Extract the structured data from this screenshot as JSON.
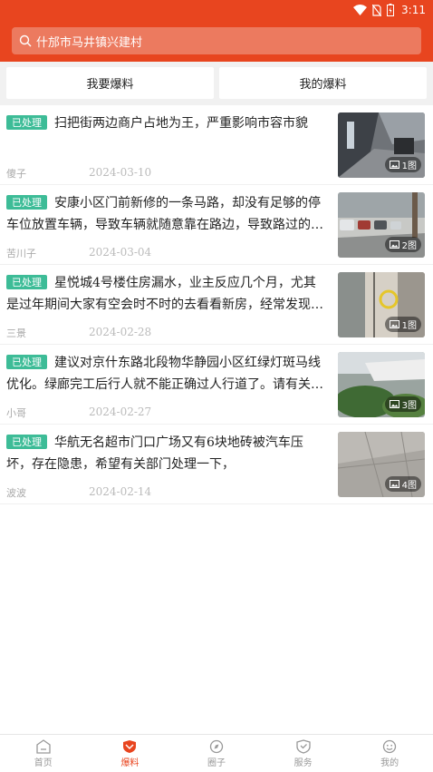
{
  "status_bar": {
    "time": "3:11"
  },
  "search": {
    "placeholder": "什邡市马井镇兴建村"
  },
  "tabs": [
    {
      "label": "我要爆料"
    },
    {
      "label": "我的爆料"
    }
  ],
  "items": [
    {
      "status": "已处理",
      "title": "扫把街两边商户占地为王，严重影响市容市貌",
      "author": "傻子",
      "date": "2024-03-10",
      "image_count": "1图"
    },
    {
      "status": "已处理",
      "title": "安康小区门前新修的一条马路，却没有足够的停车位放置车辆，导致车辆就随意靠在路边，导致路过的行人通行困难",
      "author": "苦川子",
      "date": "2024-03-04",
      "image_count": "2图"
    },
    {
      "status": "已处理",
      "title": "星悦城4号楼住房漏水，业主反应几个月，尤其是过年期间大家有空会时不时的去看看新房，经常发现漏水",
      "author": "三景",
      "date": "2024-02-28",
      "image_count": "1图"
    },
    {
      "status": "已处理",
      "title": "建议对京什东路北段物华静园小区红绿灯斑马线优化。绿廊完工后行人就不能正确过人行道了。请有关部门尽快处理",
      "author": "小哥",
      "date": "2024-02-27",
      "image_count": "3图"
    },
    {
      "status": "已处理",
      "title": "华航无名超市门口广场又有6块地砖被汽车压坏，存在隐患，希望有关部门处理一下，",
      "author": "波波",
      "date": "2024-02-14",
      "image_count": "4图"
    }
  ],
  "bottom_nav": [
    {
      "label": "首页",
      "icon": "home-icon"
    },
    {
      "label": "爆料",
      "icon": "report-icon",
      "active": true
    },
    {
      "label": "圈子",
      "icon": "compass-icon"
    },
    {
      "label": "服务",
      "icon": "service-icon"
    },
    {
      "label": "我的",
      "icon": "profile-icon"
    }
  ],
  "colors": {
    "brand": "#e8451f",
    "badge": "#3dbc97",
    "search_bg": "#ec7a5f"
  }
}
